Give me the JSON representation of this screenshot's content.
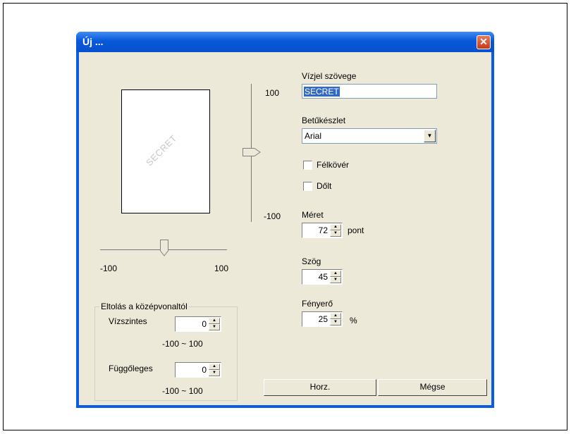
{
  "window": {
    "title": "Új ...",
    "close_glyph": "✕"
  },
  "preview": {
    "watermark_text": "SECRET",
    "watermark_angle_deg": 45
  },
  "horizontal_slider": {
    "min_label": "-100",
    "max_label": "100",
    "value": 0
  },
  "vertical_slider": {
    "max_label": "100",
    "min_label": "-100",
    "value": 0
  },
  "offset_group": {
    "title": "Eltolás a középvonaltól",
    "horizontal_label": "Vízszintes",
    "horizontal_value": "0",
    "horizontal_range": "-100 ~ 100",
    "vertical_label": "Függőleges",
    "vertical_value": "0",
    "vertical_range": "-100 ~ 100"
  },
  "watermark_text": {
    "label": "Vízjel szövege",
    "value": "SECRET"
  },
  "font": {
    "label": "Betűkészlet",
    "value": "Arial"
  },
  "bold": {
    "label": "Félkövér",
    "checked": false
  },
  "italic": {
    "label": "Dőlt",
    "checked": false
  },
  "size": {
    "label": "Méret",
    "value": "72",
    "unit": "pont"
  },
  "angle": {
    "label": "Szög",
    "value": "45"
  },
  "brightness": {
    "label": "Fényerő",
    "value": "25",
    "unit": "%"
  },
  "buttons": {
    "ok": "Horz.",
    "cancel": "Mégse"
  },
  "icons": {
    "up": "▲",
    "down": "▼"
  },
  "colors": {
    "titlebar": "#0a5ce0",
    "dialog_bg": "#ece9d8",
    "close": "#d94a2b",
    "selection": "#316ac5"
  }
}
